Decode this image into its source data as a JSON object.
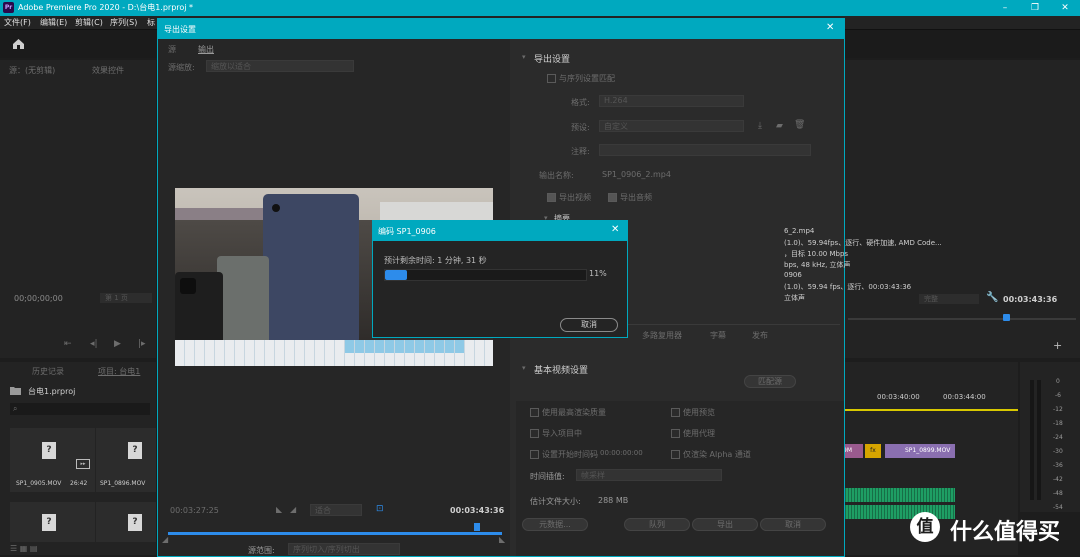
{
  "app": {
    "title": "Adobe Premiere Pro 2020 - D:\\台电1.prproj *",
    "logo": "Pr",
    "menu": [
      "文件(F)",
      "编辑(E)",
      "剪辑(C)",
      "序列(S)",
      "标"
    ],
    "window_buttons": [
      "–",
      "❐",
      "✕"
    ]
  },
  "left": {
    "source_tab": "源：(无剪辑)",
    "effects_tab": "效果控件",
    "timecode": "00;00;00;00",
    "page": "第 1 页",
    "history_tab": "历史记录",
    "project_tab": "项目: 台电1",
    "project_file": "台电1.prproj",
    "items": [
      {
        "name": "SP1_0905.MOV",
        "dur": "26:42"
      },
      {
        "name": "SP1_0896.MOV",
        "dur": ""
      }
    ]
  },
  "right": {
    "fit": "完整",
    "timecode": "00:03:43:36",
    "timeline_timecodes": [
      "00:03:40:00",
      "00:03:44:00"
    ],
    "clips": [
      "9M",
      "fx",
      "SP1_0899.MOV"
    ],
    "db_scale": [
      "0",
      "-6",
      "-12",
      "-18",
      "-24",
      "-30",
      "-36",
      "-42",
      "-48",
      "-54"
    ]
  },
  "dialog": {
    "title": "导出设置",
    "tabs": [
      "源",
      "输出"
    ],
    "source_scale_label": "源缩放:",
    "source_scale_value": "缩放以适合",
    "timecode_in": "00:03:27:25",
    "timecode_out": "00:03:43:36",
    "fit": "适合",
    "range_label": "源范围:",
    "range_value": "序列切入/序列切出",
    "export_settings": {
      "heading": "导出设置",
      "match_sequence": "与序列设置匹配",
      "format_label": "格式:",
      "format_value": "H.264",
      "preset_label": "预设:",
      "preset_value": "自定义",
      "comment_label": "注释:",
      "output_name_label": "输出名称:",
      "output_name_value": "SP1_0906_2.mp4",
      "export_video": "导出视频",
      "export_audio": "导出音频"
    },
    "summary": {
      "heading": "摘要",
      "lines": [
        "6_2.mp4",
        "(1.0)、59.94fps、逐行、硬件加速, AMD Code...",
        "，目标 10.00 Mbps",
        "bps, 48 kHz, 立体声",
        "0906",
        "(1.0)、59.94 fps、逐行、00:03:43:36",
        "立体声"
      ]
    },
    "bottom_tabs": [
      "多路复用器",
      "字幕",
      "发布"
    ],
    "basic_video": {
      "heading": "基本视频设置",
      "match_button": "匹配源"
    },
    "options": {
      "max_render": "使用最高渲染质量",
      "use_preview": "使用预览",
      "import_project": "导入项目中",
      "use_proxy": "使用代理",
      "set_start_tc": "设置开始时间码",
      "start_tc": "00:00:00:00",
      "alpha_only": "仅渲染 Alpha 通道",
      "interp_label": "时间插值:",
      "interp_value": "帧采样",
      "filesize_label": "估计文件大小:",
      "filesize_value": "288 MB"
    },
    "buttons": [
      "元数据...",
      "队列",
      "导出",
      "取消"
    ]
  },
  "encode": {
    "title": "编码 SP1_0906",
    "remaining": "预计剩余时间: 1 分钟, 31 秒",
    "percent_text": "11%",
    "progress": 0.11,
    "cancel": "取消"
  },
  "watermark": {
    "text": "什么值得买",
    "logo": "值"
  }
}
